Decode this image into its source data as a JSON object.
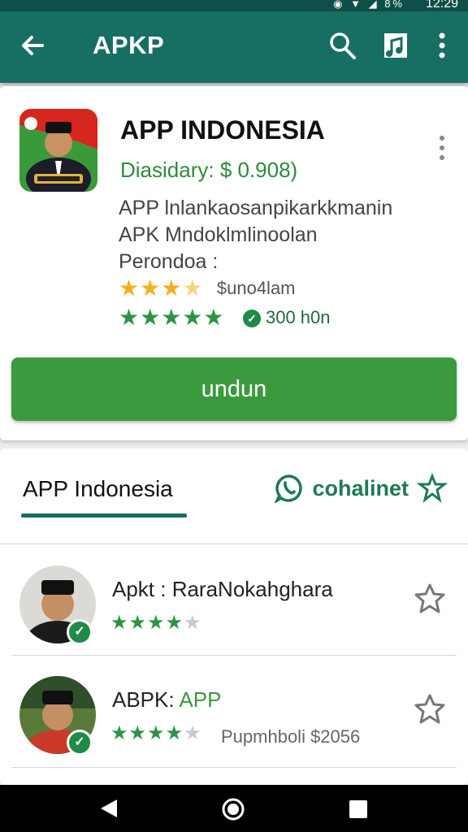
{
  "status_bar": {
    "time": "12:29",
    "icons": [
      "eye-icon",
      "wifi-icon",
      "signal-icon",
      "battery-icon"
    ],
    "battery_text": "8%"
  },
  "app_bar": {
    "title": "APKP",
    "actions": [
      "search-icon",
      "media-icon",
      "more-vert-icon"
    ],
    "color": "#176e62"
  },
  "app_card": {
    "name": "APP INDONESIA",
    "price": "Diasidary: $ 0.908)",
    "description_lines": [
      "APP lnlankaosanpikarkkmanin",
      "APK Mndoklmlinoolan",
      "Perondoa :"
    ],
    "rating": {
      "value": 3.5,
      "max": 5,
      "label": "$uno4lam"
    },
    "second_rating": {
      "value": 5,
      "max": 5,
      "installs": "300 h0n"
    },
    "install_button": "undun",
    "button_color": "#3b9a3e"
  },
  "tabs": {
    "active": "APP Indonesia",
    "right_label": "cohalinet"
  },
  "list": [
    {
      "title": "Apkt : RaraNokahghara",
      "title_prefix": "",
      "title_accent": "",
      "stars": 4,
      "max_stars": 5,
      "subtitle": ""
    },
    {
      "title": "",
      "title_prefix": "ABPK: ",
      "title_accent": "APP",
      "stars": 4,
      "max_stars": 5,
      "subtitle": "Pupmhboli $2056"
    }
  ],
  "nav_bar": {
    "buttons": [
      "back-icon",
      "home-icon",
      "recents-icon"
    ]
  }
}
